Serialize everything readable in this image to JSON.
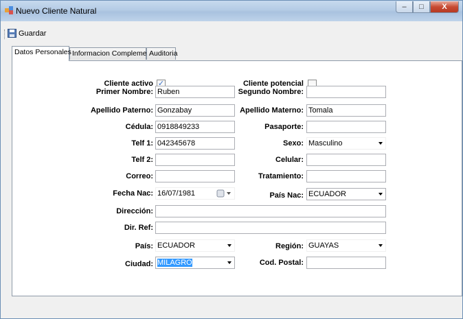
{
  "window": {
    "title": "Nuevo Cliente Natural",
    "minimize": "–",
    "maximize": "□",
    "close": "X"
  },
  "toolbar": {
    "save_label": "Guardar"
  },
  "tabs": [
    "Datos Personales",
    "Informacion Complementaria",
    "Auditoria"
  ],
  "form": {
    "cliente_activo": {
      "label": "Cliente activo",
      "checked": "✓"
    },
    "cliente_potencial": {
      "label": "Cliente potencial",
      "checked": ""
    },
    "primer_nombre": {
      "label": "Primer Nombre:",
      "value": "Ruben"
    },
    "segundo_nombre": {
      "label": "Segundo Nombre:",
      "value": ""
    },
    "apellido_paterno": {
      "label": "Apellido Paterno:",
      "value": "Gonzabay"
    },
    "apellido_materno": {
      "label": "Apellido Materno:",
      "value": "Tomala"
    },
    "cedula": {
      "label": "Cédula:",
      "value": "0918849233"
    },
    "pasaporte": {
      "label": "Pasaporte:",
      "value": ""
    },
    "telf1": {
      "label": "Telf 1:",
      "value": "042345678"
    },
    "sexo": {
      "label": "Sexo:",
      "value": "Masculino"
    },
    "telf2": {
      "label": "Telf 2:",
      "value": ""
    },
    "celular": {
      "label": "Celular:",
      "value": ""
    },
    "correo": {
      "label": "Correo:",
      "value": ""
    },
    "tratamiento": {
      "label": "Tratamiento:",
      "value": ""
    },
    "fecha_nac": {
      "label": "Fecha Nac:",
      "value": "16/07/1981"
    },
    "pais_nac": {
      "label": "País Nac:",
      "value": "ECUADOR"
    },
    "direccion": {
      "label": "Dirección:",
      "value": ""
    },
    "dir_ref": {
      "label": "Dir. Ref:",
      "value": ""
    },
    "pais": {
      "label": "País:",
      "value": "ECUADOR"
    },
    "region": {
      "label": "Región:",
      "value": "GUAYAS"
    },
    "ciudad": {
      "label": "Ciudad:",
      "value": "MILAGRO"
    },
    "cod_postal": {
      "label": "Cod. Postal:",
      "value": ""
    }
  }
}
